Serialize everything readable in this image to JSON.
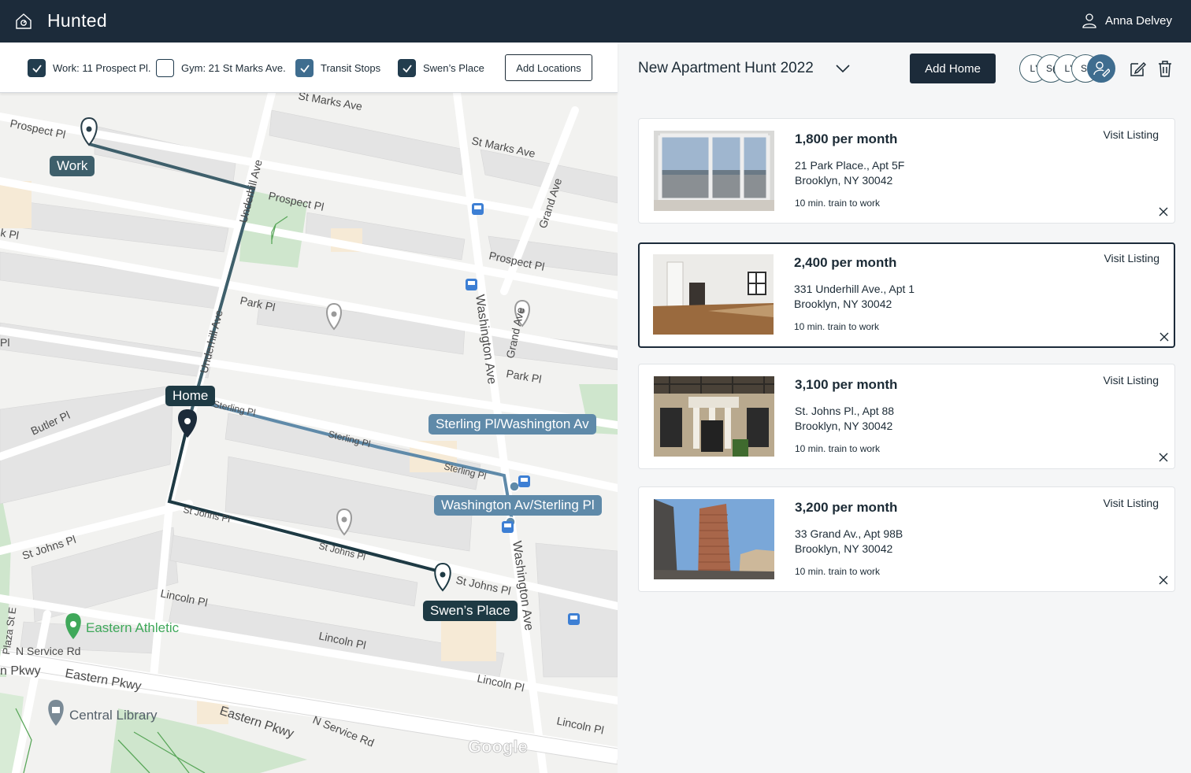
{
  "app": {
    "title": "Hunted",
    "user_name": "Anna Delvey"
  },
  "filters": [
    {
      "label": "Work: 11 Prospect Pl.",
      "checked": true
    },
    {
      "label": "Gym: 21 St Marks Ave.",
      "checked": false
    },
    {
      "label": "Transit Stops",
      "checked": true
    },
    {
      "label": "Swen’s Place",
      "checked": true
    }
  ],
  "add_locations_label": "Add Locations",
  "map": {
    "labels": {
      "work": "Work",
      "home": "Home",
      "swens": "Swen’s Place",
      "sterling_stop": "Sterling Pl/Washington Av",
      "washington_stop": "Washington Av/Sterling Pl"
    },
    "streets": {
      "st_marks_top": "St Marks Ave",
      "st_marks": "St Marks Ave",
      "prospect_pl_left": "Prospect Pl",
      "prospect_pl_mid": "Prospect Pl",
      "prospect_pl_right": "Prospect Pl",
      "k_pl": "k Pl",
      "park_pl": "Park Pl",
      "park_pl_right": "Park Pl",
      "underhill_top": "Underhill Ave",
      "underhill_mid": "Underhill Ave",
      "grand_top": "Grand Ave",
      "grand_mid": "Grand Ave",
      "washington_top": "Washington Ave",
      "washington_bottom": "Washington Ave",
      "sterling_1": "Sterling Pl",
      "sterling_2": "Sterling Pl",
      "sterling_3": "Sterling Pl",
      "butler": "Butler Pl",
      "st_johns_left": "St Johns Pl",
      "st_johns_1": "St Johns Pl",
      "st_johns_2": "St Johns Pl",
      "st_johns_3": "St Johns Pl",
      "lincoln_1": "Lincoln Pl",
      "lincoln_2": "Lincoln Pl",
      "lincoln_3": "Lincoln Pl",
      "lincoln_4": "Lincoln Pl",
      "plaza": "Plaza St E",
      "n_service_left": "N Service Rd",
      "n_service_right": "N Service Rd",
      "eastern_left": "n Pkwy",
      "eastern_1": "Eastern Pkwy",
      "eastern_2": "Eastern Pkwy",
      "pl_edge": "Pl"
    },
    "pois": {
      "eastern_athletic": "Eastern Athletic",
      "central_library": "Central Library"
    },
    "watermark": "Google"
  },
  "hunt": {
    "title": "New Apartment Hunt 2022",
    "add_home_label": "Add Home"
  },
  "avatars": [
    "L'",
    "S(",
    "L'",
    "S("
  ],
  "listings": [
    {
      "price": "1,800 per month",
      "address1": "21 Park Place., Apt 5F",
      "address2": "Brooklyn, NY 30042",
      "commute": "10 min. train to work",
      "visit_label": "Visit Listing",
      "selected": false
    },
    {
      "price": "2,400 per month",
      "address1": "331 Underhill Ave., Apt 1",
      "address2": "Brooklyn, NY 30042",
      "commute": "10 min. train to work",
      "visit_label": "Visit Listing",
      "selected": true
    },
    {
      "price": "3,100 per month",
      "address1": "St. Johns Pl., Apt 88",
      "address2": "Brooklyn, NY 30042",
      "commute": "10 min. train to work",
      "visit_label": "Visit Listing",
      "selected": false
    },
    {
      "price": "3,200 per month",
      "address1": "33 Grand Av., Apt 98B",
      "address2": "Brooklyn, NY 30042",
      "commute": "10 min. train to work",
      "visit_label": "Visit Listing",
      "selected": false
    }
  ],
  "colors": {
    "topbar": "#1c2b3a",
    "route_dark": "#1e3a44",
    "route_slate": "#3e5f6b",
    "route_blue": "#5f8aa9",
    "accent": "#3f6d8f"
  }
}
